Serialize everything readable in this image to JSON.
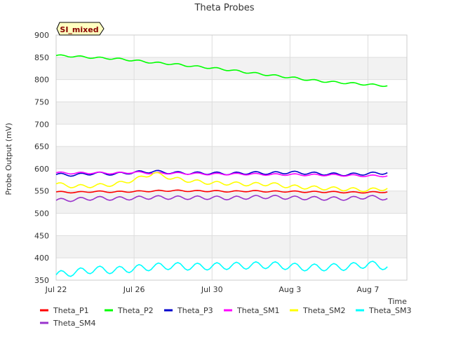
{
  "chart_data": {
    "type": "line",
    "title": "Theta Probes",
    "xlabel": "Time",
    "ylabel": "Probe Output (mV)",
    "badge": "SI_mixed",
    "grid": true,
    "legend_position": "bottom",
    "xlim": [
      "2023-07-22",
      "2023-08-09"
    ],
    "ylim": [
      350,
      900
    ],
    "x_ticks": [
      {
        "date": "2023-07-22",
        "label": "Jul 22"
      },
      {
        "date": "2023-07-26",
        "label": "Jul 26"
      },
      {
        "date": "2023-07-30",
        "label": "Jul 30"
      },
      {
        "date": "2023-08-03",
        "label": "Aug 3"
      },
      {
        "date": "2023-08-07",
        "label": "Aug 7"
      }
    ],
    "y_ticks": [
      350,
      400,
      450,
      500,
      550,
      600,
      650,
      700,
      750,
      800,
      850,
      900
    ],
    "x": [
      "2023-07-22",
      "2023-07-23",
      "2023-07-24",
      "2023-07-25",
      "2023-07-26",
      "2023-07-27",
      "2023-07-28",
      "2023-07-29",
      "2023-07-30",
      "2023-07-31",
      "2023-08-01",
      "2023-08-02",
      "2023-08-03",
      "2023-08-04",
      "2023-08-05",
      "2023-08-06",
      "2023-08-07",
      "2023-08-08"
    ],
    "series": [
      {
        "name": "Theta_P1",
        "color": "#ff0000",
        "values": [
          548,
          547,
          549,
          548,
          549,
          550,
          551,
          550,
          550,
          549,
          550,
          549,
          549,
          548,
          548,
          547,
          547,
          548
        ]
      },
      {
        "name": "Theta_P2",
        "color": "#00ff00",
        "values": [
          854,
          852,
          849,
          847,
          843,
          838,
          835,
          830,
          826,
          821,
          815,
          810,
          805,
          799,
          795,
          792,
          789,
          786
        ]
      },
      {
        "name": "Theta_P3",
        "color": "#0000cc",
        "values": [
          587,
          586,
          590,
          588,
          592,
          594,
          591,
          590,
          590,
          589,
          591,
          590,
          592,
          590,
          588,
          587,
          589,
          591
        ]
      },
      {
        "name": "Theta_SM1",
        "color": "#ff00ff",
        "values": [
          591,
          590,
          591,
          590,
          592,
          590,
          590,
          589,
          588,
          588,
          588,
          587,
          587,
          586,
          586,
          585,
          584,
          584
        ]
      },
      {
        "name": "Theta_SM2",
        "color": "#ffff00",
        "values": [
          566,
          560,
          562,
          565,
          575,
          590,
          578,
          572,
          568,
          567,
          565,
          566,
          560,
          558,
          556,
          554,
          552,
          556
        ]
      },
      {
        "name": "Theta_SM3",
        "color": "#00ffff",
        "values": [
          362,
          368,
          374,
          372,
          376,
          380,
          382,
          380,
          381,
          382,
          383,
          384,
          381,
          378,
          379,
          380,
          386,
          380
        ]
      },
      {
        "name": "Theta_SM4",
        "color": "#9933cc",
        "values": [
          529,
          531,
          534,
          533,
          534,
          536,
          535,
          535,
          535,
          534,
          536,
          537,
          535,
          534,
          533,
          533,
          537,
          533
        ]
      }
    ]
  }
}
